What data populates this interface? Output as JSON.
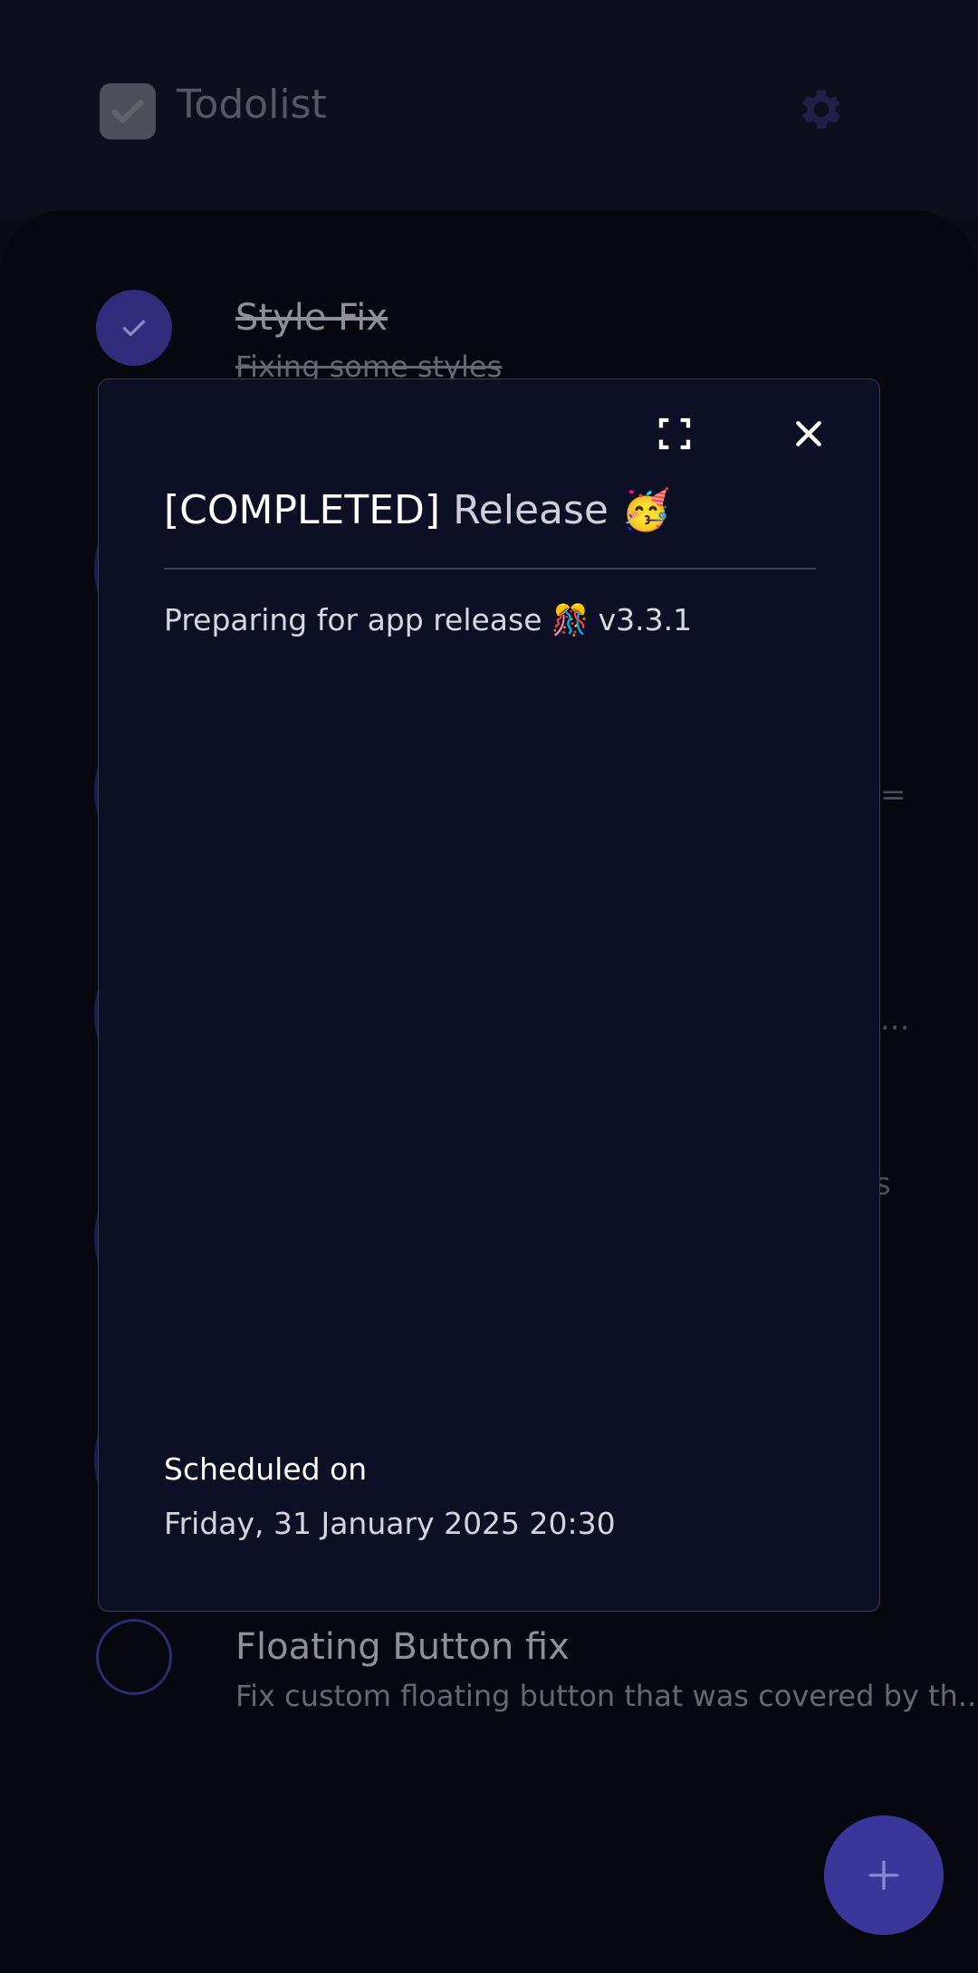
{
  "app": {
    "title": "Todolist"
  },
  "todos": [
    {
      "title": "Style Fix",
      "description": "Fixing some styles",
      "completed": true
    },
    {
      "title": "Floating Button fix",
      "description": "Fix custom floating button that was covered by th...",
      "completed": false
    }
  ],
  "background_fragments": {
    "row3_edge": "=",
    "row4_edge": "...",
    "row5_edge": "s"
  },
  "modal": {
    "status": "[COMPLETED]",
    "name": "Release 🥳",
    "description": "Preparing for app release 🎊 v3.3.1",
    "scheduled_label": "Scheduled on",
    "scheduled_date": "Friday, 31 January 2025 20:30"
  },
  "icons": {
    "app": "checkbox-icon",
    "settings": "gear-icon",
    "expand": "fullscreen-icon",
    "close": "close-icon",
    "add": "plus-icon",
    "check": "check-icon"
  },
  "colors": {
    "accent": "#3a369a",
    "modal_bg": "#0d0f24",
    "background": "#07070f"
  }
}
